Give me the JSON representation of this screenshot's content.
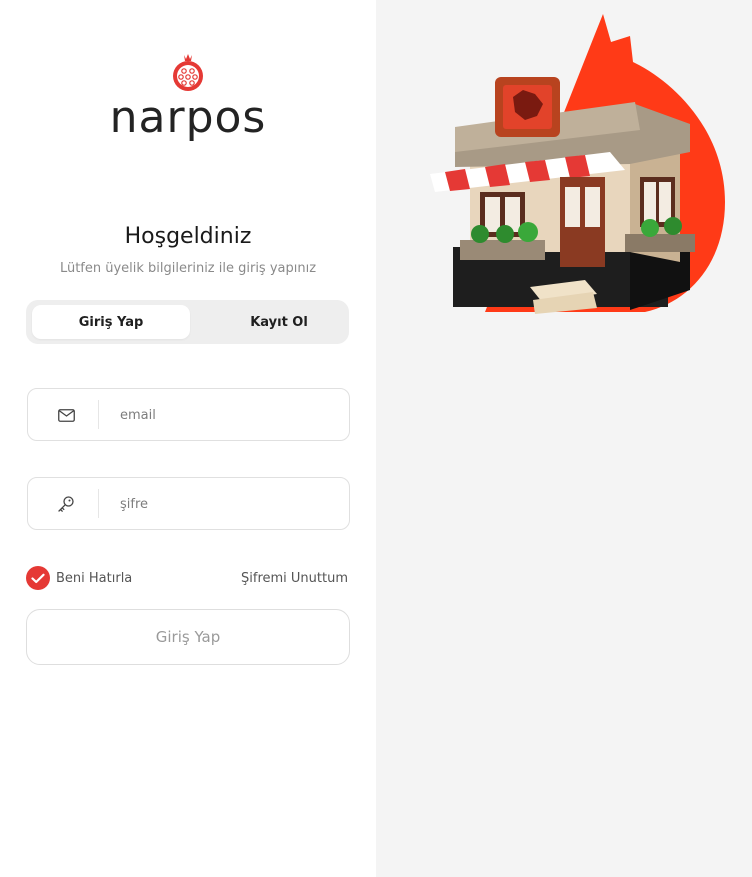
{
  "brand": {
    "name": "narpos",
    "accent_color": "#e53935"
  },
  "login": {
    "title": "Hoşgeldiniz",
    "subtitle": "Lütfen üyelik bilgileriniz ile giriş yapınız",
    "tabs": [
      {
        "label": "Giriş Yap",
        "active": true
      },
      {
        "label": "Kayıt Ol",
        "active": false
      }
    ],
    "email": {
      "placeholder": "email",
      "value": "",
      "icon": "mail-icon"
    },
    "password": {
      "placeholder": "şifre",
      "value": "",
      "icon": "key-icon"
    },
    "remember": {
      "label": "Beni Hatırla",
      "checked": true
    },
    "forgot_label": "Şifremi Unuttum",
    "submit_label": "Giriş Yap"
  },
  "illustration": {
    "subject": "storefront-3d-illustration"
  }
}
